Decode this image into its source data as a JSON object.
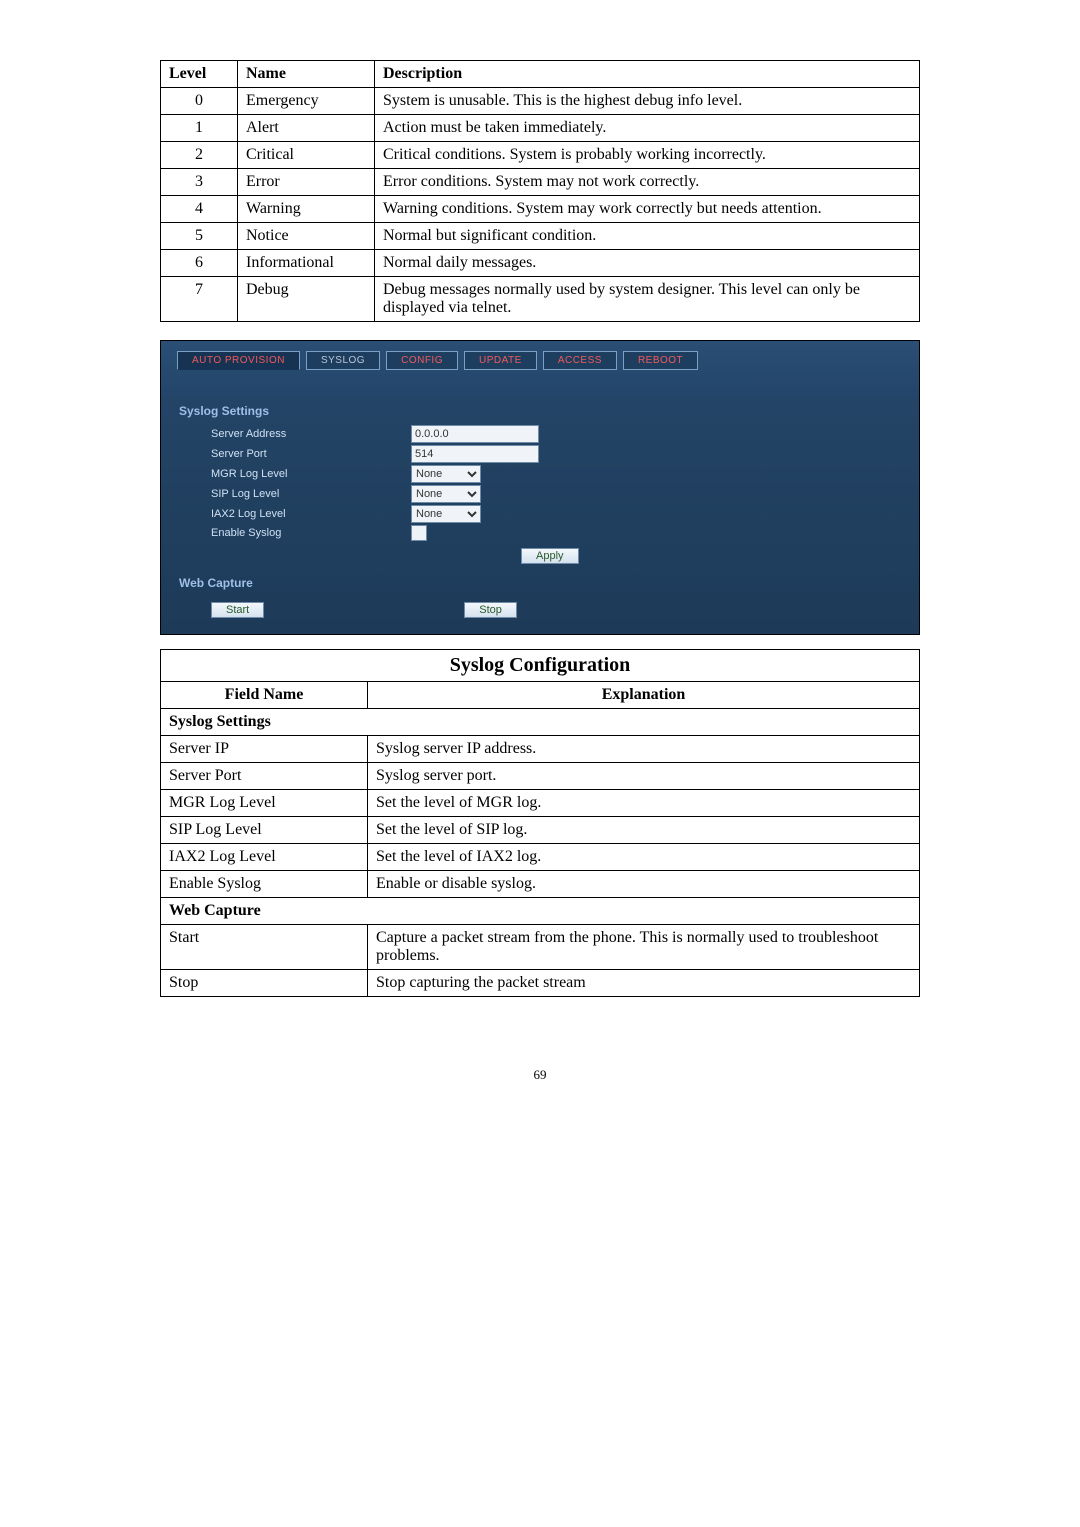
{
  "levels_table": {
    "headers": {
      "level": "Level",
      "name": "Name",
      "desc": "Description"
    },
    "rows": [
      {
        "level": "0",
        "name": "Emergency",
        "desc": "System is unusable.    This is the highest debug info level."
      },
      {
        "level": "1",
        "name": "Alert",
        "desc": "Action must be taken immediately."
      },
      {
        "level": "2",
        "name": "Critical",
        "desc": "Critical conditions. System is probably working incorrectly."
      },
      {
        "level": "3",
        "name": "Error",
        "desc": "Error conditions. System may not work correctly."
      },
      {
        "level": "4",
        "name": "Warning",
        "desc": "Warning conditions. System may work correctly but needs attention."
      },
      {
        "level": "5",
        "name": "Notice",
        "desc": "Normal but significant condition."
      },
      {
        "level": "6",
        "name": "Informational",
        "desc": "Normal daily messages."
      },
      {
        "level": "7",
        "name": "Debug",
        "desc": "Debug messages normally used by system designer.    This level can only be displayed via telnet."
      }
    ]
  },
  "shot": {
    "tabs": {
      "auto_provision": "AUTO PROVISION",
      "syslog": "SYSLOG",
      "config": "CONFIG",
      "update": "UPDATE",
      "access": "ACCESS",
      "reboot": "REBOOT"
    },
    "syslog_section": "Syslog Settings",
    "labels": {
      "server_address": "Server Address",
      "server_port": "Server Port",
      "mgr": "MGR Log Level",
      "sip": "SIP Log Level",
      "iax2": "IAX2 Log Level",
      "enable": "Enable Syslog"
    },
    "values": {
      "server_address": "0.0.0.0",
      "server_port": "514",
      "mgr": "None",
      "sip": "None",
      "iax2": "None"
    },
    "apply": "Apply",
    "web_capture_section": "Web Capture",
    "start": "Start",
    "stop": "Stop"
  },
  "config_table": {
    "title": "Syslog Configuration",
    "headers": {
      "field": "Field Name",
      "expl": "Explanation"
    },
    "section1": "Syslog Settings",
    "rows1": [
      {
        "field": "Server IP",
        "expl": "Syslog server IP address."
      },
      {
        "field": "Server Port",
        "expl": "Syslog server port."
      },
      {
        "field": "MGR Log Level",
        "expl": "Set the level of MGR log."
      },
      {
        "field": "SIP Log Level",
        "expl": "Set the level of SIP log."
      },
      {
        "field": "IAX2 Log Level",
        "expl": "Set the level of IAX2 log."
      },
      {
        "field": "Enable Syslog",
        "expl": "Enable or disable syslog."
      }
    ],
    "section2": "Web Capture",
    "rows2": [
      {
        "field": "Start",
        "expl": "Capture a packet stream from the phone.    This is normally used to troubleshoot problems."
      },
      {
        "field": "Stop",
        "expl": "Stop capturing the packet stream"
      }
    ]
  },
  "page_number": "69"
}
